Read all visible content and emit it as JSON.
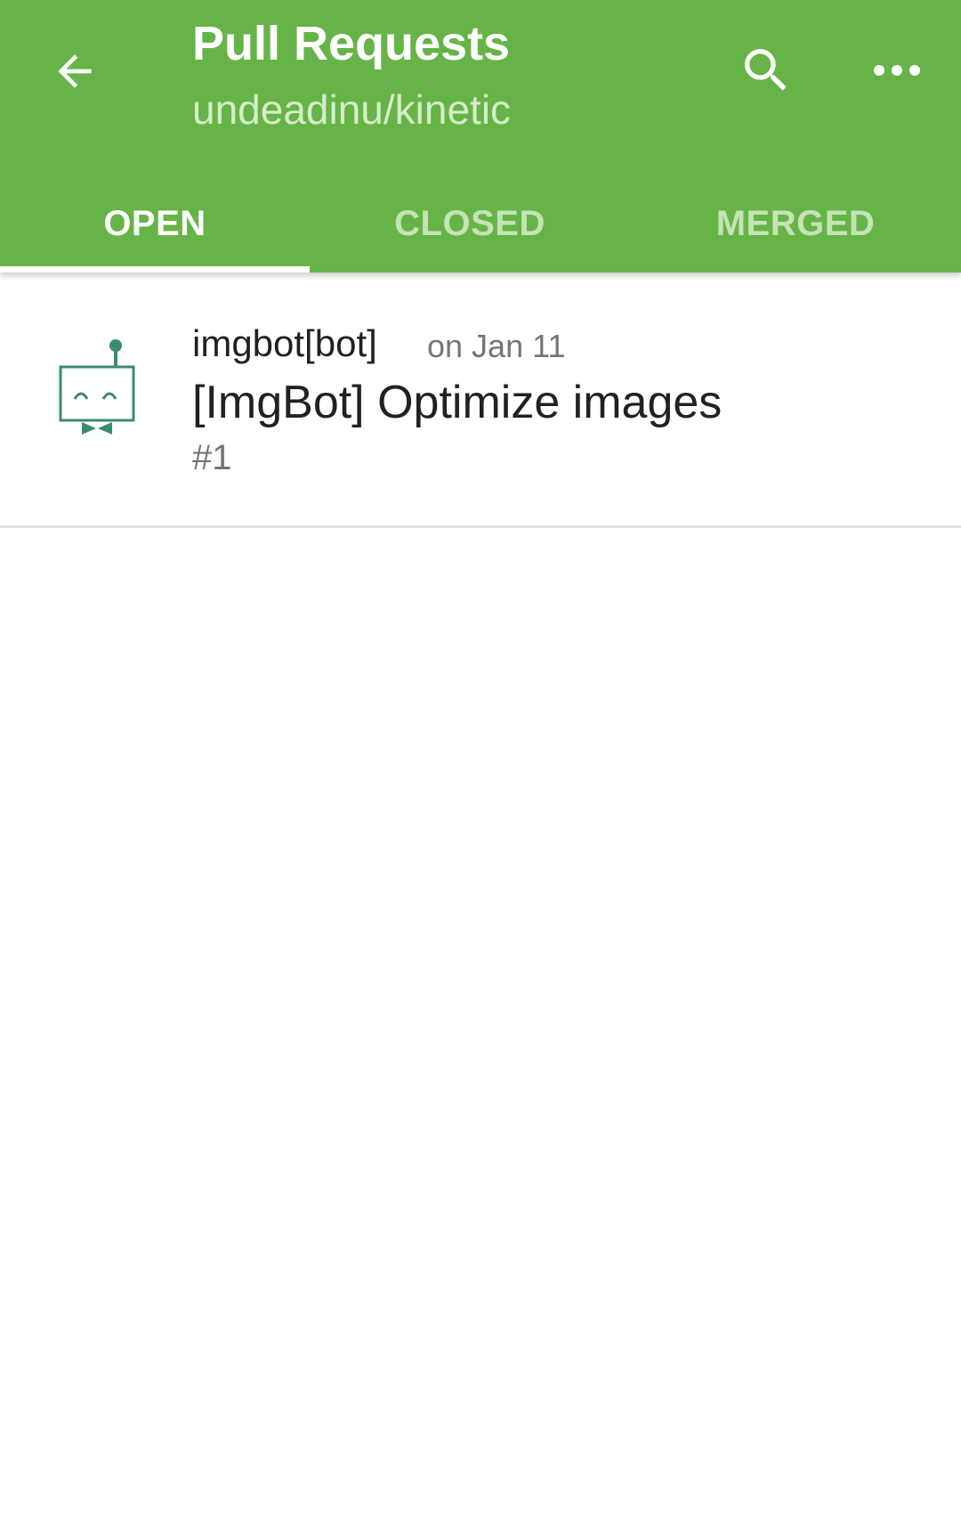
{
  "header": {
    "title": "Pull Requests",
    "subtitle": "undeadinu/kinetic",
    "back_icon": "arrow-back-icon",
    "search_icon": "search-icon",
    "more_icon": "more-horizontal-icon"
  },
  "tabs": [
    {
      "label": "OPEN",
      "selected": true
    },
    {
      "label": "CLOSED",
      "selected": false
    },
    {
      "label": "MERGED",
      "selected": false
    }
  ],
  "pull_requests": [
    {
      "author": "imgbot[bot]",
      "date": "on Jan 11",
      "title": "[ImgBot] Optimize images",
      "number": "#1",
      "avatar_icon": "robot-avatar-icon"
    }
  ],
  "colors": {
    "primary": "#66b447",
    "avatar": "#3d8a72"
  }
}
